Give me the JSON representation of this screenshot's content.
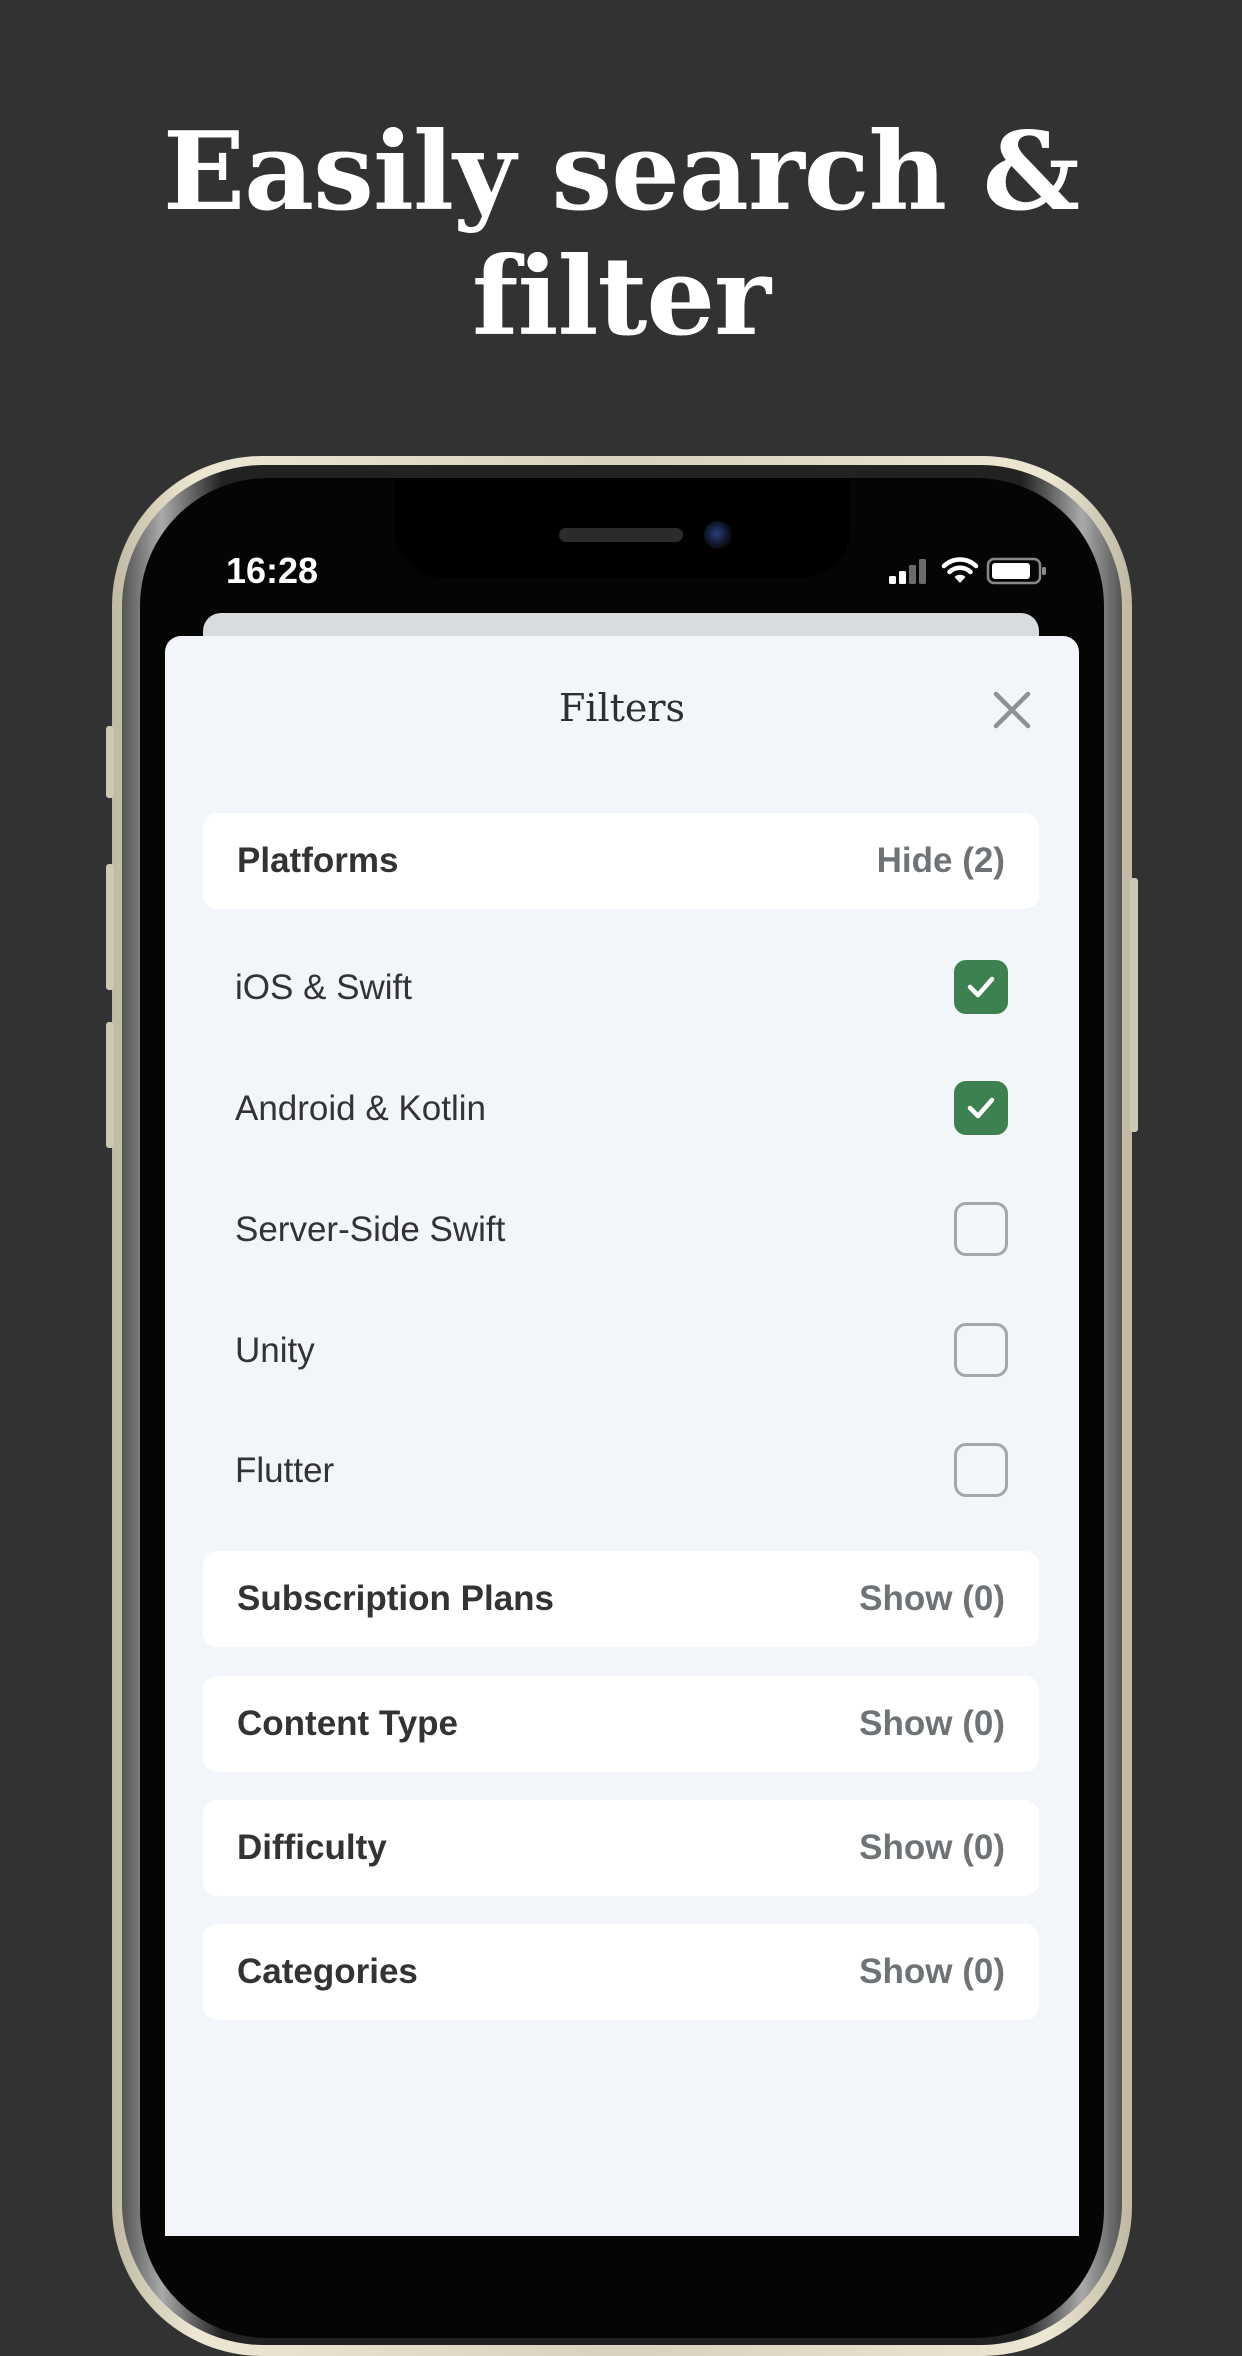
{
  "headline": {
    "line1": "Easily search &",
    "line2": "filter"
  },
  "status_bar": {
    "time": "16:28",
    "icons": [
      "cellular-signal-icon",
      "wifi-icon",
      "battery-icon"
    ]
  },
  "sheet": {
    "title": "Filters",
    "close_icon": "close-icon"
  },
  "sections": {
    "platforms": {
      "title": "Platforms",
      "toggle": "Hide (2)"
    },
    "subscription_plans": {
      "title": "Subscription Plans",
      "toggle": "Show (0)"
    },
    "content_type": {
      "title": "Content Type",
      "toggle": "Show (0)"
    },
    "difficulty": {
      "title": "Difficulty",
      "toggle": "Show (0)"
    },
    "categories": {
      "title": "Categories",
      "toggle": "Show (0)"
    }
  },
  "platform_options": [
    {
      "label": "iOS & Swift",
      "checked": true
    },
    {
      "label": "Android & Kotlin",
      "checked": true
    },
    {
      "label": "Server-Side Swift",
      "checked": false
    },
    {
      "label": "Unity",
      "checked": false
    },
    {
      "label": "Flutter",
      "checked": false
    }
  ],
  "colors": {
    "background": "#323232",
    "sheet": "#f2f5f9",
    "checkbox_checked": "#3d8150",
    "checkbox_border": "#a3a7ab",
    "toggle_text": "#6e7376"
  }
}
